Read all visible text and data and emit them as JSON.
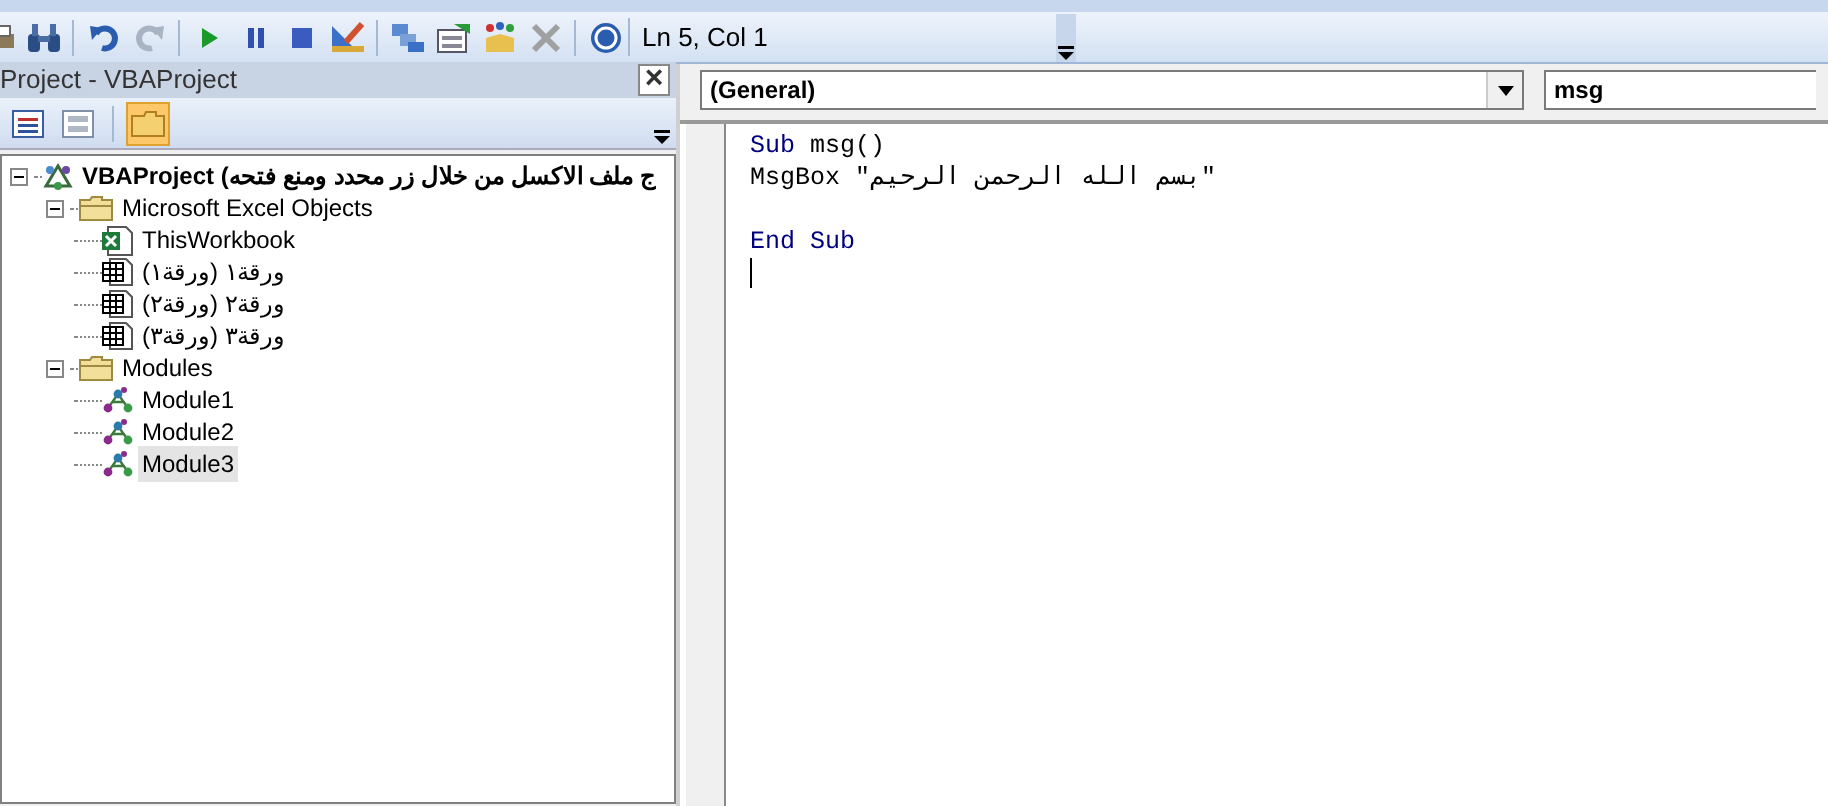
{
  "toolbar": {
    "status": "Ln 5, Col 1"
  },
  "project_explorer": {
    "title": "Project - VBAProject",
    "close": "×",
    "tree": [
      {
        "kind": "project",
        "label": "VBAProject (ج ملف الاكسل من خلال زر محدد ومنع فتحه",
        "expanded": true,
        "selected": false,
        "children": [
          {
            "kind": "folder",
            "label": "Microsoft Excel Objects",
            "expanded": true,
            "selected": false,
            "children": [
              {
                "kind": "workbook",
                "label": "ThisWorkbook",
                "selected": false
              },
              {
                "kind": "sheet",
                "label": "ورقة١ (ورقة١)",
                "selected": false
              },
              {
                "kind": "sheet",
                "label": "ورقة٢ (ورقة٢)",
                "selected": false
              },
              {
                "kind": "sheet",
                "label": "ورقة٣ (ورقة٣)",
                "selected": false
              }
            ]
          },
          {
            "kind": "folder",
            "label": "Modules",
            "expanded": true,
            "selected": false,
            "children": [
              {
                "kind": "module",
                "label": "Module1",
                "selected": false
              },
              {
                "kind": "module",
                "label": "Module2",
                "selected": false
              },
              {
                "kind": "module",
                "label": "Module3",
                "selected": true
              }
            ]
          }
        ]
      }
    ]
  },
  "code_window": {
    "object_dropdown": "(General)",
    "procedure_dropdown": "msg",
    "lines": [
      {
        "kind": "code",
        "segments": [
          {
            "kind": "keyword",
            "text": "Sub"
          },
          {
            "kind": "plain",
            "text": " msg()"
          }
        ]
      },
      {
        "kind": "code",
        "segments": [
          {
            "kind": "plain",
            "text": "MsgBox \"بسم الله الرحمن الرحيم\""
          }
        ]
      },
      {
        "kind": "blank"
      },
      {
        "kind": "code",
        "segments": [
          {
            "kind": "keyword",
            "text": "End Sub"
          }
        ]
      },
      {
        "kind": "cursor"
      }
    ]
  }
}
